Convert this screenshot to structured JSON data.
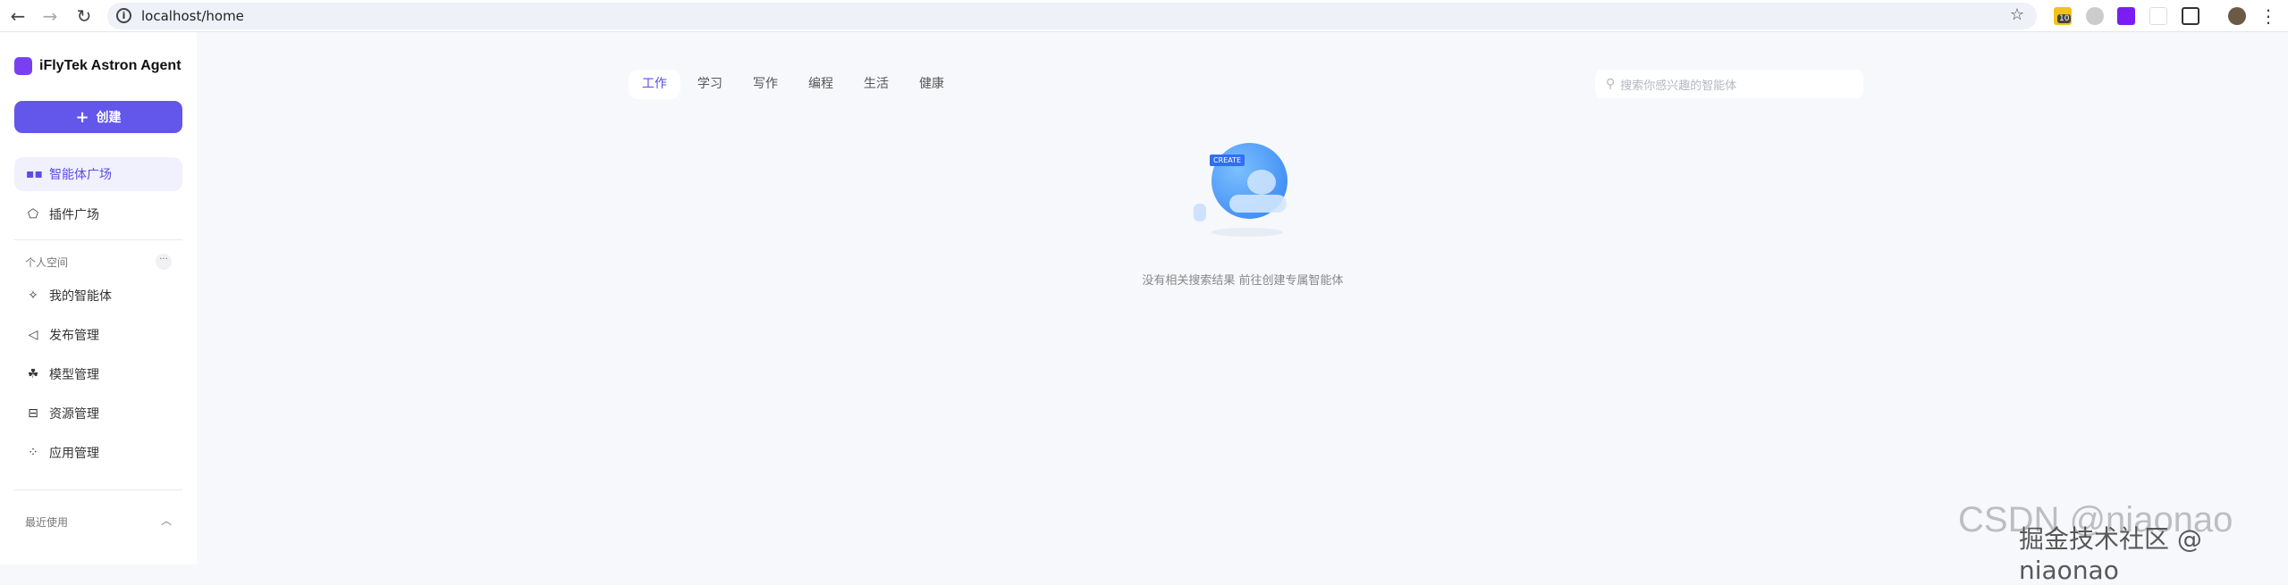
{
  "browser": {
    "url": "localhost/home",
    "ext_badge": "10"
  },
  "sidebar": {
    "app_title": "iFlyTek Astron Agent",
    "create_label": "创建",
    "nav": [
      {
        "label": "智能体广场",
        "icon": "grid-icon"
      },
      {
        "label": "插件广场",
        "icon": "puzzle-icon"
      }
    ],
    "personal_section": "个人空间",
    "personal_items": [
      {
        "label": "我的智能体",
        "icon": "sparkle-icon"
      },
      {
        "label": "发布管理",
        "icon": "send-icon"
      },
      {
        "label": "模型管理",
        "icon": "model-icon"
      },
      {
        "label": "资源管理",
        "icon": "resource-icon"
      },
      {
        "label": "应用管理",
        "icon": "apps-icon"
      }
    ],
    "recent_section": "最近使用"
  },
  "main": {
    "tabs": [
      "工作",
      "学习",
      "写作",
      "编程",
      "生活",
      "健康"
    ],
    "search_placeholder": "搜索你感兴趣的智能体",
    "illustration_badge": "CREATE",
    "empty_text": "没有相关搜索结果 前往创建专属智能体"
  },
  "watermark": {
    "csdn": "CSDN @niaonao",
    "juejin": "掘金技术社区 @ niaonao"
  },
  "colors": {
    "accent": "#6356ea",
    "active_bg": "#f1f0fd",
    "page_bg": "#f7f8fc"
  }
}
